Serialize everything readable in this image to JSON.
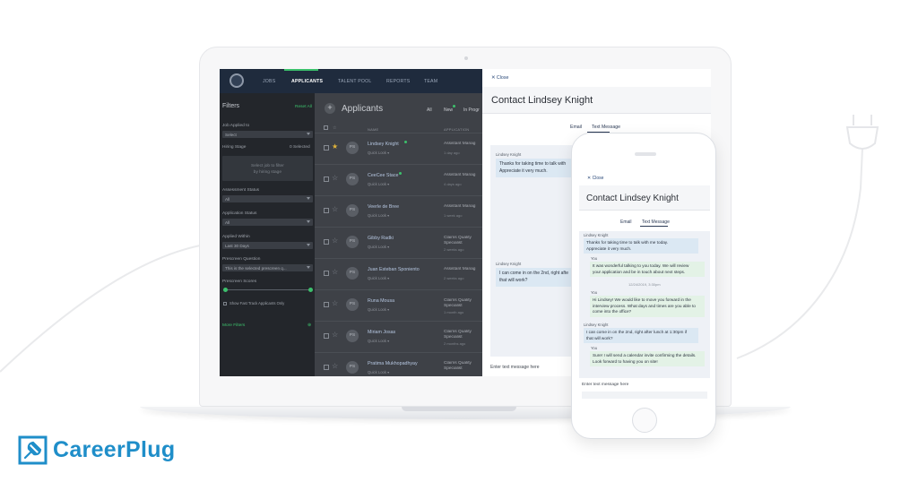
{
  "brand": {
    "name": "CareerPlug",
    "color": "#1f8ec9"
  },
  "nav": {
    "items": [
      "JOBS",
      "APPLICANTS",
      "TALENT POOL",
      "REPORTS",
      "TEAM"
    ],
    "active": "APPLICANTS",
    "accent": "#3cc06c"
  },
  "sidebar": {
    "title": "Filters",
    "reset_label": "Reset All",
    "job_label": "Job Applied to",
    "job_value": "Select",
    "stage_label": "Hiring Stage",
    "stage_count": "0 Selected",
    "stage_placeholder": "Select job to filter\nby hiring stage",
    "assessment_label": "Assessment Status",
    "assessment_value": "All",
    "application_label": "Application Status",
    "application_value": "All",
    "applied_label": "Applied Within",
    "applied_value": "Last 30 Days",
    "prescreen_q_label": "Prescreen Question",
    "prescreen_q_value": "This is the selected prescreen q...",
    "prescreen_s_label": "Prescreen Scores",
    "fast_track_label": "Show Fast Track Applicants Only",
    "more_filters": "More Filters"
  },
  "list": {
    "title": "Applicants",
    "tabs": [
      "All",
      "New",
      "In Progr"
    ],
    "col_name": "NAME",
    "col_app": "APPLICATION",
    "rows": [
      {
        "initials": "PS",
        "name": "Lindsey Knight",
        "quick": "Quick Look",
        "job": "Assistant Manag",
        "date": "1 day ago",
        "starred": true,
        "dot": true
      },
      {
        "initials": "PS",
        "name": "CeeCee Stace",
        "quick": "Quick Look",
        "job": "Assistant Manag",
        "date": "4 days ago",
        "starred": false,
        "dot": true
      },
      {
        "initials": "PS",
        "name": "Veerle de Bree",
        "quick": "Quick Look",
        "job": "Assistant Manag",
        "date": "1 week ago",
        "starred": false,
        "dot": false
      },
      {
        "initials": "PS",
        "name": "Gibby Radki",
        "quick": "Quick Look",
        "job": "Claims Quality",
        "job2": "Specialist",
        "date": "2 weeks ago",
        "starred": false,
        "dot": false
      },
      {
        "initials": "PS",
        "name": "Juan Esteban Sponiento",
        "quick": "Quick Look",
        "job": "Assistant Manag",
        "date": "2 weeks ago",
        "starred": false,
        "dot": false
      },
      {
        "initials": "PS",
        "name": "Runa Mousa",
        "quick": "Quick Look",
        "job": "Claims Quality",
        "job2": "Specialist",
        "date": "1 month ago",
        "starred": false,
        "dot": false
      },
      {
        "initials": "PS",
        "name": "Miriam Josas",
        "quick": "Quick Look",
        "job": "Claims Quality",
        "job2": "Specialist",
        "date": "2 months ago",
        "starred": false,
        "dot": false
      },
      {
        "initials": "PS",
        "name": "Pratima Mukhopadhyay",
        "quick": "Quick Look",
        "job": "Claims Quality",
        "job2": "Specialist",
        "date": "",
        "starred": false,
        "dot": false
      }
    ]
  },
  "panel": {
    "close_label": "Close",
    "title": "Contact Lindsey Knight",
    "tab_email": "Email",
    "tab_text": "Text Message",
    "msg1_sender": "Lindsey Knight",
    "msg1_text": "Thanks for taking time to talk with\nAppreciate it very much.",
    "msg2_sender": "Lindsey Knight",
    "msg2_text": "I can come in on the 2nd, right afte\nthat will work?",
    "enter_placeholder": "Enter text message here"
  },
  "phone": {
    "close_label": "Close",
    "title": "Contact Lindsey Knight",
    "tab_email": "Email",
    "tab_text": "Text Message",
    "m1_sender": "Lindsey Knight",
    "m1_text": "Thanks for taking time to talk with me today.\nAppreciate it very much.",
    "m2_sender": "You",
    "m2_text": "It was wonderful talking to you today. We will review\nyour application and be in touch about next steps.",
    "timestamp": "12/24/2019, 3:30pm",
    "m3_sender": "You",
    "m3_text": "Hi Lindsey! We would like to move you forward in the\ninterview process. What days and times are you able to\ncome into the office?",
    "m4_sender": "Lindsey Knight",
    "m4_text": "I can come in on the 2nd, right after lunch at 1:30pm if\nthat will work?",
    "m5_sender": "You",
    "m5_text": "Sure! I will send a calendar invite confirming the details.\nLook forward to having you on site!",
    "enter_placeholder": "Enter text message here"
  }
}
